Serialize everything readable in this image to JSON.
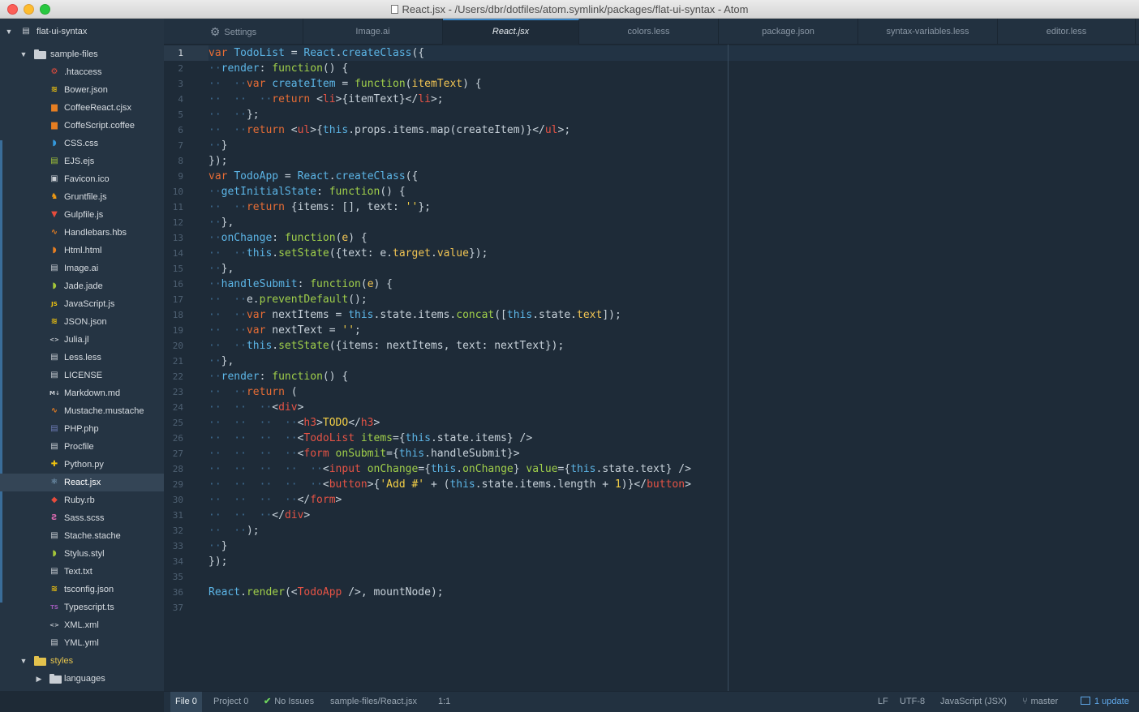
{
  "window": {
    "title": "React.jsx - /Users/dbr/dotfiles/atom.symlink/packages/flat-ui-syntax - Atom"
  },
  "sidebar": {
    "root": "flat-ui-syntax",
    "folder": "sample-files",
    "files": [
      {
        "name": ".htaccess",
        "icon": "gear-icon",
        "color": "#e74c3c",
        "glyph": "⚙"
      },
      {
        "name": "Bower.json",
        "icon": "database-icon",
        "color": "#f1c40f",
        "glyph": "≋"
      },
      {
        "name": "CoffeeReact.cjsx",
        "icon": "coffee-icon",
        "color": "#e67e22",
        "glyph": "▆"
      },
      {
        "name": "CoffeScript.coffee",
        "icon": "coffee-icon",
        "color": "#e67e22",
        "glyph": "▆"
      },
      {
        "name": "CSS.css",
        "icon": "css3-icon",
        "color": "#3498db",
        "glyph": "◗"
      },
      {
        "name": "EJS.ejs",
        "icon": "file-code-icon",
        "color": "#a4c639",
        "glyph": "▤"
      },
      {
        "name": "Favicon.ico",
        "icon": "image-file-icon",
        "color": "#c9ced4",
        "glyph": "▣"
      },
      {
        "name": "Gruntfile.js",
        "icon": "grunt-icon",
        "color": "#f39c12",
        "glyph": "♞"
      },
      {
        "name": "Gulpfile.js",
        "icon": "gulp-icon",
        "color": "#e74c3c",
        "glyph": "▼"
      },
      {
        "name": "Handlebars.hbs",
        "icon": "mustache-icon",
        "color": "#e67e22",
        "glyph": "∿"
      },
      {
        "name": "Html.html",
        "icon": "html5-icon",
        "color": "#e67e22",
        "glyph": "◗"
      },
      {
        "name": "Image.ai",
        "icon": "file-text-icon",
        "color": "#c9ced4",
        "glyph": "▤"
      },
      {
        "name": "Jade.jade",
        "icon": "jade-icon",
        "color": "#a4c639",
        "glyph": "◗"
      },
      {
        "name": "JavaScript.js",
        "icon": "js-icon",
        "color": "#f1c40f",
        "glyph": "JS"
      },
      {
        "name": "JSON.json",
        "icon": "database-icon",
        "color": "#f1c40f",
        "glyph": "≋"
      },
      {
        "name": "Julia.jl",
        "icon": "code-icon",
        "color": "#c9ced4",
        "glyph": "<>"
      },
      {
        "name": "Less.less",
        "icon": "file-text-icon",
        "color": "#c9ced4",
        "glyph": "▤"
      },
      {
        "name": "LICENSE",
        "icon": "file-text-icon",
        "color": "#c9ced4",
        "glyph": "▤"
      },
      {
        "name": "Markdown.md",
        "icon": "markdown-icon",
        "color": "#c9ced4",
        "glyph": "M↓"
      },
      {
        "name": "Mustache.mustache",
        "icon": "mustache-icon",
        "color": "#e67e22",
        "glyph": "∿"
      },
      {
        "name": "PHP.php",
        "icon": "php-icon",
        "color": "#6c7ab5",
        "glyph": "▤"
      },
      {
        "name": "Procfile",
        "icon": "file-text-icon",
        "color": "#c9ced4",
        "glyph": "▤"
      },
      {
        "name": "Python.py",
        "icon": "python-icon",
        "color": "#f1c40f",
        "glyph": "✚"
      },
      {
        "name": "React.jsx",
        "icon": "react-icon",
        "color": "#9ac6e8",
        "glyph": "⚛"
      },
      {
        "name": "Ruby.rb",
        "icon": "ruby-icon",
        "color": "#e74c3c",
        "glyph": "◆"
      },
      {
        "name": "Sass.scss",
        "icon": "sass-icon",
        "color": "#d96ab0",
        "glyph": "Ƨ"
      },
      {
        "name": "Stache.stache",
        "icon": "file-text-icon",
        "color": "#c9ced4",
        "glyph": "▤"
      },
      {
        "name": "Stylus.styl",
        "icon": "stylus-icon",
        "color": "#a4c639",
        "glyph": "◗"
      },
      {
        "name": "Text.txt",
        "icon": "file-text-icon",
        "color": "#c9ced4",
        "glyph": "▤"
      },
      {
        "name": "tsconfig.json",
        "icon": "database-icon",
        "color": "#f1c40f",
        "glyph": "≋"
      },
      {
        "name": "Typescript.ts",
        "icon": "typescript-icon",
        "color": "#9b59b6",
        "glyph": "TS"
      },
      {
        "name": "XML.xml",
        "icon": "code-icon",
        "color": "#c9ced4",
        "glyph": "<>"
      },
      {
        "name": "YML.yml",
        "icon": "file-text-icon",
        "color": "#c9ced4",
        "glyph": "▤"
      }
    ],
    "styles_folder": "styles",
    "languages_folder": "languages",
    "colors_file": "colors.less"
  },
  "tabs": [
    {
      "label": "Settings",
      "icon": "settings-icon"
    },
    {
      "label": "Image.ai"
    },
    {
      "label": "React.jsx",
      "active": true
    },
    {
      "label": "colors.less"
    },
    {
      "label": "package.json"
    },
    {
      "label": "syntax-variables.less"
    },
    {
      "label": "editor.less"
    }
  ],
  "editor": {
    "current_line": 1,
    "lines": [
      [
        [
          "kw",
          "var "
        ],
        [
          "def",
          "TodoList"
        ],
        [
          "pl",
          " = "
        ],
        [
          "def",
          "React"
        ],
        [
          "pl",
          "."
        ],
        [
          "def",
          "createClass"
        ],
        [
          "pl",
          "({"
        ]
      ],
      [
        [
          "ind",
          "··"
        ],
        [
          "def",
          "render"
        ],
        [
          "pl",
          ": "
        ],
        [
          "fn",
          "function"
        ],
        [
          "pl",
          "() {"
        ]
      ],
      [
        [
          "ind",
          "··  ··"
        ],
        [
          "kw",
          "var "
        ],
        [
          "def",
          "createItem"
        ],
        [
          "pl",
          " = "
        ],
        [
          "fn",
          "function"
        ],
        [
          "pl",
          "("
        ],
        [
          "prop",
          "itemText"
        ],
        [
          "pl",
          ") {"
        ]
      ],
      [
        [
          "ind",
          "··  ··  ··"
        ],
        [
          "kw",
          "return "
        ],
        [
          "pl",
          "<"
        ],
        [
          "tag",
          "li"
        ],
        [
          "pl",
          ">{itemText}</"
        ],
        [
          "tag",
          "li"
        ],
        [
          "pl",
          ">;"
        ]
      ],
      [
        [
          "ind",
          "··  ··"
        ],
        [
          "pl",
          "};"
        ]
      ],
      [
        [
          "ind",
          "··  ··"
        ],
        [
          "kw",
          "return "
        ],
        [
          "pl",
          "<"
        ],
        [
          "tag",
          "ul"
        ],
        [
          "pl",
          ">{"
        ],
        [
          "def",
          "this"
        ],
        [
          "pl",
          ".props.items.map(createItem)}</"
        ],
        [
          "tag",
          "ul"
        ],
        [
          "pl",
          ">;"
        ]
      ],
      [
        [
          "ind",
          "··"
        ],
        [
          "pl",
          "}"
        ]
      ],
      [
        [
          "pl",
          "});"
        ]
      ],
      [
        [
          "kw",
          "var "
        ],
        [
          "def",
          "TodoApp"
        ],
        [
          "pl",
          " = "
        ],
        [
          "def",
          "React"
        ],
        [
          "pl",
          "."
        ],
        [
          "def",
          "createClass"
        ],
        [
          "pl",
          "({"
        ]
      ],
      [
        [
          "ind",
          "··"
        ],
        [
          "def",
          "getInitialState"
        ],
        [
          "pl",
          ": "
        ],
        [
          "fn",
          "function"
        ],
        [
          "pl",
          "() {"
        ]
      ],
      [
        [
          "ind",
          "··  ··"
        ],
        [
          "kw",
          "return "
        ],
        [
          "pl",
          "{items: [], text: "
        ],
        [
          "str",
          "''"
        ],
        [
          "pl",
          "};"
        ]
      ],
      [
        [
          "ind",
          "··"
        ],
        [
          "pl",
          "},"
        ]
      ],
      [
        [
          "ind",
          "··"
        ],
        [
          "def",
          "onChange"
        ],
        [
          "pl",
          ": "
        ],
        [
          "fn",
          "function"
        ],
        [
          "pl",
          "("
        ],
        [
          "prop",
          "e"
        ],
        [
          "pl",
          ") {"
        ]
      ],
      [
        [
          "ind",
          "··  ··"
        ],
        [
          "def",
          "this"
        ],
        [
          "pl",
          "."
        ],
        [
          "fn",
          "setState"
        ],
        [
          "pl",
          "({text: e."
        ],
        [
          "prop",
          "target"
        ],
        [
          "pl",
          "."
        ],
        [
          "prop",
          "value"
        ],
        [
          "pl",
          "});"
        ]
      ],
      [
        [
          "ind",
          "··"
        ],
        [
          "pl",
          "},"
        ]
      ],
      [
        [
          "ind",
          "··"
        ],
        [
          "def",
          "handleSubmit"
        ],
        [
          "pl",
          ": "
        ],
        [
          "fn",
          "function"
        ],
        [
          "pl",
          "("
        ],
        [
          "prop",
          "e"
        ],
        [
          "pl",
          ") {"
        ]
      ],
      [
        [
          "ind",
          "··  ··"
        ],
        [
          "pl",
          "e."
        ],
        [
          "fn",
          "preventDefault"
        ],
        [
          "pl",
          "();"
        ]
      ],
      [
        [
          "ind",
          "··  ··"
        ],
        [
          "kw",
          "var "
        ],
        [
          "pl",
          "nextItems = "
        ],
        [
          "def",
          "this"
        ],
        [
          "pl",
          ".state.items."
        ],
        [
          "fn",
          "concat"
        ],
        [
          "pl",
          "(["
        ],
        [
          "def",
          "this"
        ],
        [
          "pl",
          ".state."
        ],
        [
          "prop",
          "text"
        ],
        [
          "pl",
          "]);"
        ]
      ],
      [
        [
          "ind",
          "··  ··"
        ],
        [
          "kw",
          "var "
        ],
        [
          "pl",
          "nextText = "
        ],
        [
          "str",
          "''"
        ],
        [
          "pl",
          ";"
        ]
      ],
      [
        [
          "ind",
          "··  ··"
        ],
        [
          "def",
          "this"
        ],
        [
          "pl",
          "."
        ],
        [
          "fn",
          "setState"
        ],
        [
          "pl",
          "({items: nextItems, text: nextText});"
        ]
      ],
      [
        [
          "ind",
          "··"
        ],
        [
          "pl",
          "},"
        ]
      ],
      [
        [
          "ind",
          "··"
        ],
        [
          "def",
          "render"
        ],
        [
          "pl",
          ": "
        ],
        [
          "fn",
          "function"
        ],
        [
          "pl",
          "() {"
        ]
      ],
      [
        [
          "ind",
          "··  ··"
        ],
        [
          "kw",
          "return "
        ],
        [
          "pl",
          "("
        ]
      ],
      [
        [
          "ind",
          "··  ··  ··"
        ],
        [
          "pl",
          "<"
        ],
        [
          "tag",
          "div"
        ],
        [
          "pl",
          ">"
        ]
      ],
      [
        [
          "ind",
          "··  ··  ··  ··"
        ],
        [
          "pl",
          "<"
        ],
        [
          "tag",
          "h3"
        ],
        [
          "pl",
          ">"
        ],
        [
          "str",
          "TODO"
        ],
        [
          "pl",
          "</"
        ],
        [
          "tag",
          "h3"
        ],
        [
          "pl",
          ">"
        ]
      ],
      [
        [
          "ind",
          "··  ··  ··  ··"
        ],
        [
          "pl",
          "<"
        ],
        [
          "tag",
          "TodoList "
        ],
        [
          "attr",
          "items"
        ],
        [
          "pl",
          "={"
        ],
        [
          "def",
          "this"
        ],
        [
          "pl",
          ".state.items} />"
        ]
      ],
      [
        [
          "ind",
          "··  ··  ··  ··"
        ],
        [
          "pl",
          "<"
        ],
        [
          "tag",
          "form "
        ],
        [
          "attr",
          "onSubmit"
        ],
        [
          "pl",
          "={"
        ],
        [
          "def",
          "this"
        ],
        [
          "pl",
          ".handleSubmit}>"
        ]
      ],
      [
        [
          "ind",
          "··  ··  ··  ··  ··"
        ],
        [
          "pl",
          "<"
        ],
        [
          "tag",
          "input "
        ],
        [
          "attr",
          "onChange"
        ],
        [
          "pl",
          "={"
        ],
        [
          "def",
          "this"
        ],
        [
          "pl",
          "."
        ],
        [
          "fn",
          "onChange"
        ],
        [
          "pl",
          "} "
        ],
        [
          "attr",
          "value"
        ],
        [
          "pl",
          "={"
        ],
        [
          "def",
          "this"
        ],
        [
          "pl",
          ".state.text} />"
        ]
      ],
      [
        [
          "ind",
          "··  ··  ··  ··  ··"
        ],
        [
          "pl",
          "<"
        ],
        [
          "tag",
          "button"
        ],
        [
          "pl",
          ">{"
        ],
        [
          "str",
          "'Add #'"
        ],
        [
          "pl",
          " + ("
        ],
        [
          "def",
          "this"
        ],
        [
          "pl",
          ".state.items.length + "
        ],
        [
          "str",
          "1"
        ],
        [
          "pl",
          ")}</"
        ],
        [
          "tag",
          "button"
        ],
        [
          "pl",
          ">"
        ]
      ],
      [
        [
          "ind",
          "··  ··  ··  ··"
        ],
        [
          "pl",
          "</"
        ],
        [
          "tag",
          "form"
        ],
        [
          "pl",
          ">"
        ]
      ],
      [
        [
          "ind",
          "··  ··  ··"
        ],
        [
          "pl",
          "</"
        ],
        [
          "tag",
          "div"
        ],
        [
          "pl",
          ">"
        ]
      ],
      [
        [
          "ind",
          "··  ··"
        ],
        [
          "pl",
          ");"
        ]
      ],
      [
        [
          "ind",
          "··"
        ],
        [
          "pl",
          "}"
        ]
      ],
      [
        [
          "pl",
          "});"
        ]
      ],
      [],
      [
        [
          "def",
          "React"
        ],
        [
          "pl",
          "."
        ],
        [
          "fn",
          "render"
        ],
        [
          "pl",
          "(<"
        ],
        [
          "tag",
          "TodoApp "
        ],
        [
          "pl",
          "/>, mountNode);"
        ]
      ],
      []
    ]
  },
  "statusbar": {
    "file_tab": "File 0",
    "project_tab": "Project 0",
    "issues": "No Issues",
    "path": "sample-files/React.jsx",
    "cursor": "1:1",
    "line_ending": "LF",
    "encoding": "UTF-8",
    "grammar": "JavaScript (JSX)",
    "branch": "master",
    "updates": "1 update"
  }
}
